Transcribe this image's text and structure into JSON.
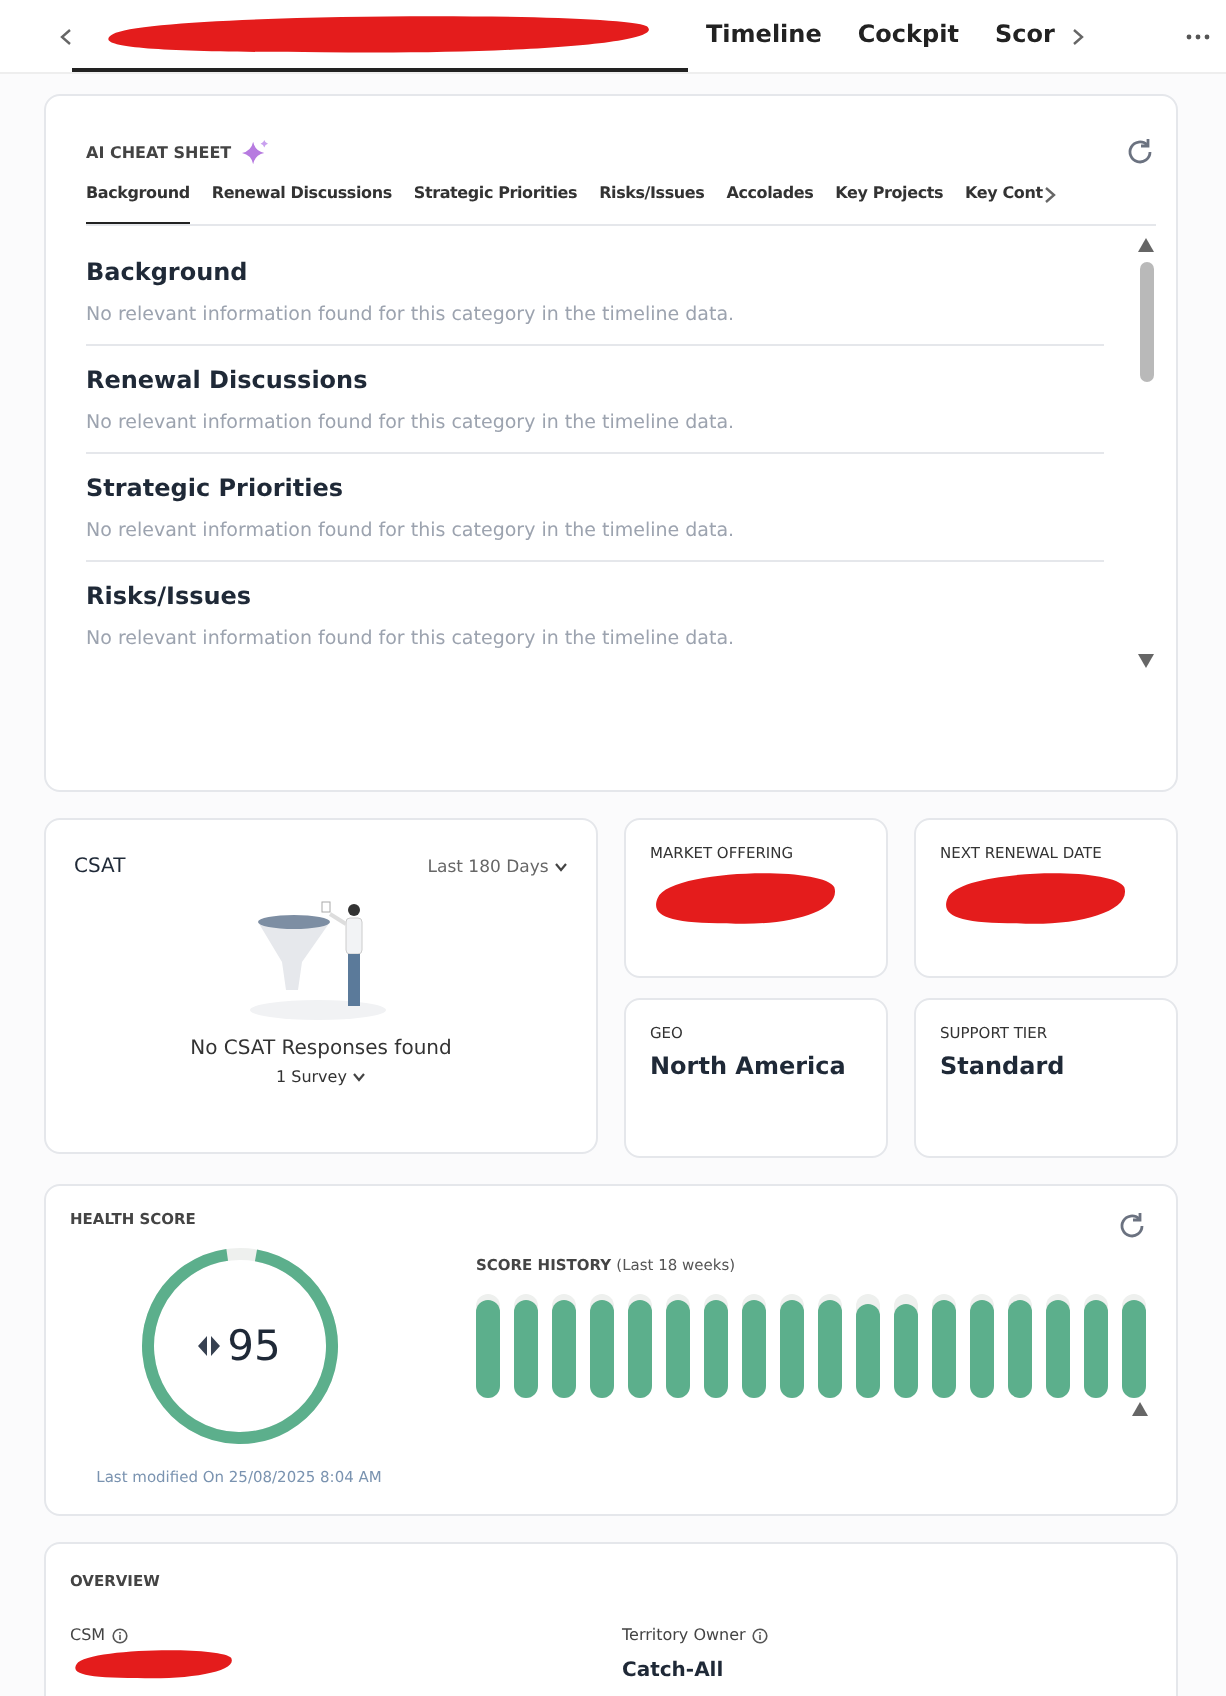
{
  "nav": {
    "tabs": [
      {
        "kind": "redacted",
        "selected": true
      },
      {
        "kind": "text",
        "label": "Timeline",
        "selected": false
      },
      {
        "kind": "text",
        "label": "Cockpit",
        "selected": false
      },
      {
        "kind": "text",
        "label": "Scor",
        "selected": false
      }
    ]
  },
  "cheat_sheet": {
    "title": "AI CHEAT SHEET",
    "tabs": [
      {
        "label": "Background",
        "selected": true
      },
      {
        "label": "Renewal Discussions",
        "selected": false
      },
      {
        "label": "Strategic Priorities",
        "selected": false
      },
      {
        "label": "Risks/Issues",
        "selected": false
      },
      {
        "label": "Accolades",
        "selected": false
      },
      {
        "label": "Key Projects",
        "selected": false
      },
      {
        "label": "Key Cont",
        "selected": false
      }
    ],
    "sections": [
      {
        "title": "Background",
        "text": "No relevant information found for this category in the timeline data."
      },
      {
        "title": "Renewal Discussions",
        "text": "No relevant information found for this category in the timeline data."
      },
      {
        "title": "Strategic Priorities",
        "text": "No relevant information found for this category in the timeline data."
      },
      {
        "title": "Risks/Issues",
        "text": "No relevant information found for this category in the timeline data."
      }
    ]
  },
  "csat": {
    "title": "CSAT",
    "period": "Last 180 Days",
    "message": "No CSAT Responses found",
    "survey": "1 Survey"
  },
  "info_cards": [
    {
      "label": "MARKET OFFERING",
      "redacted": true
    },
    {
      "label": "NEXT RENEWAL DATE",
      "redacted": true
    },
    {
      "label": "GEO",
      "value": "North America",
      "redacted": false
    },
    {
      "label": "SUPPORT TIER",
      "value": "Standard",
      "redacted": false
    }
  ],
  "health": {
    "title": "HEALTH SCORE",
    "score": "95",
    "level": 0.95,
    "history_title": "SCORE HISTORY",
    "history_note": "(Last 18 weeks)",
    "bars": [
      {
        "level": 0.95
      },
      {
        "level": 0.95
      },
      {
        "level": 0.95
      },
      {
        "level": 0.95
      },
      {
        "level": 0.95
      },
      {
        "level": 0.95
      },
      {
        "level": 0.95
      },
      {
        "level": 0.95
      },
      {
        "level": 0.95
      },
      {
        "level": 0.95
      },
      {
        "level": 0.9
      },
      {
        "level": 0.9
      },
      {
        "level": 0.95
      },
      {
        "level": 0.95
      },
      {
        "level": 0.95
      },
      {
        "level": 0.95
      },
      {
        "level": 0.95
      },
      {
        "level": 0.95
      }
    ],
    "modified": "Last modified On 25/08/2025 8:04 AM"
  },
  "overview": {
    "title": "OVERVIEW",
    "fields": [
      {
        "label": "CSM",
        "redacted": true
      },
      {
        "label": "Territory Owner",
        "value": "Catch-All",
        "redacted": false
      }
    ]
  }
}
